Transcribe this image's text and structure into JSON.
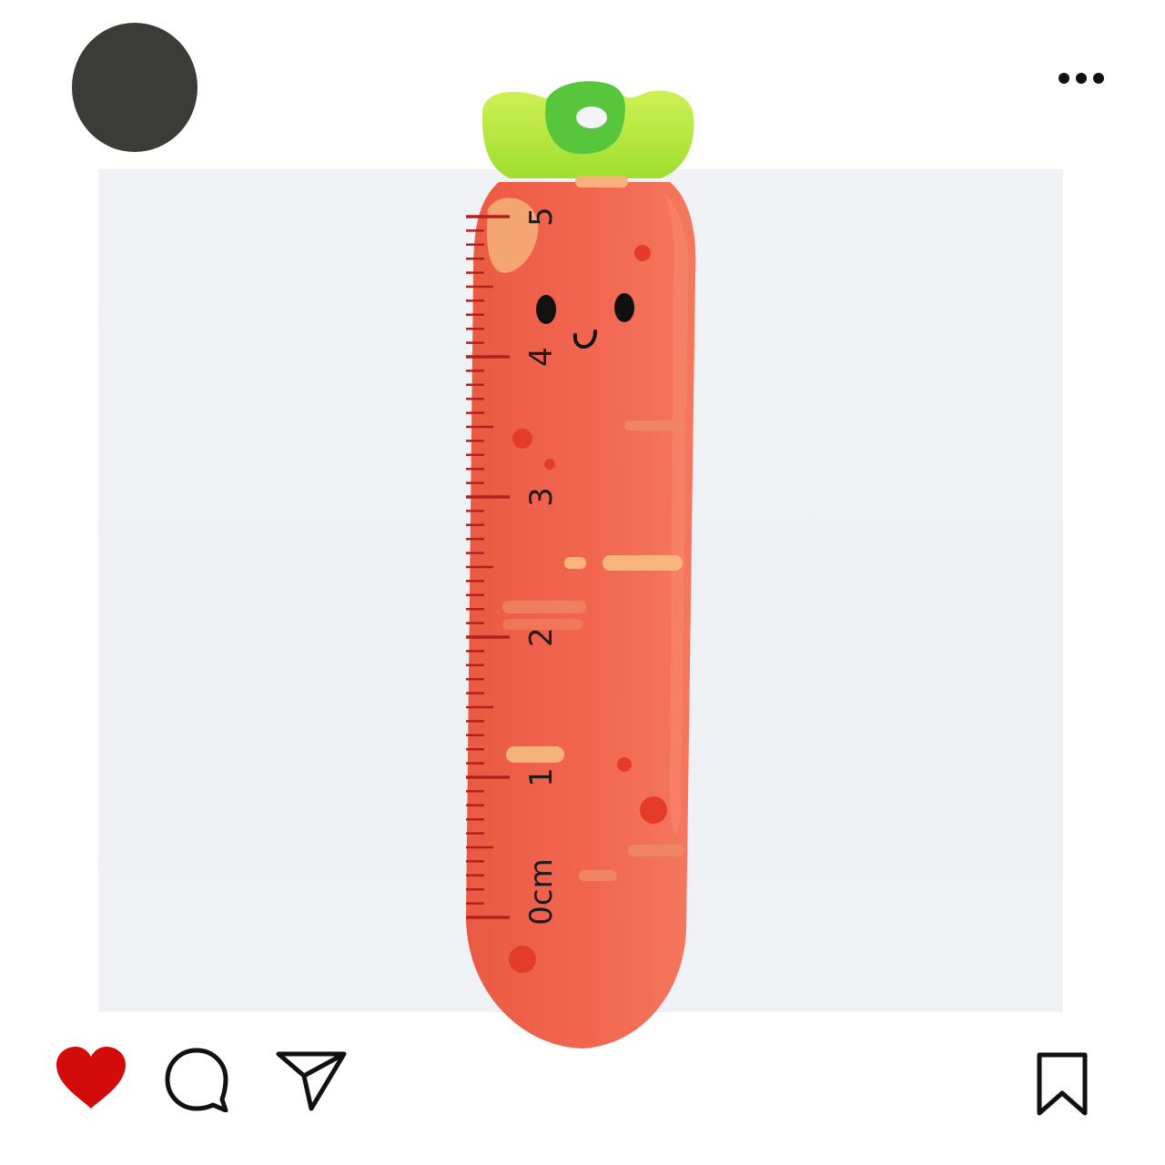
{
  "post": {
    "avatar": {
      "color": "#3b3b38"
    },
    "more_icon": "more-horizontal-icon"
  },
  "photo": {
    "subject": "carrot-shaped-ruler",
    "ruler": {
      "unit_label": "0cm",
      "numbers": [
        "1",
        "2",
        "3",
        "4",
        "5"
      ]
    },
    "colors": {
      "carrot": "#f0624a",
      "carrot_light": "#f6826a",
      "leaf": "#b6e83a",
      "leaf_dark": "#4fc83a",
      "ink": "#b3201c",
      "background": "#f0f1f5"
    }
  },
  "actions": {
    "like_icon": "heart-icon",
    "like_state": "liked",
    "like_color": "#d30b0b",
    "comment_icon": "comment-icon",
    "share_icon": "send-icon",
    "save_icon": "bookmark-icon"
  }
}
